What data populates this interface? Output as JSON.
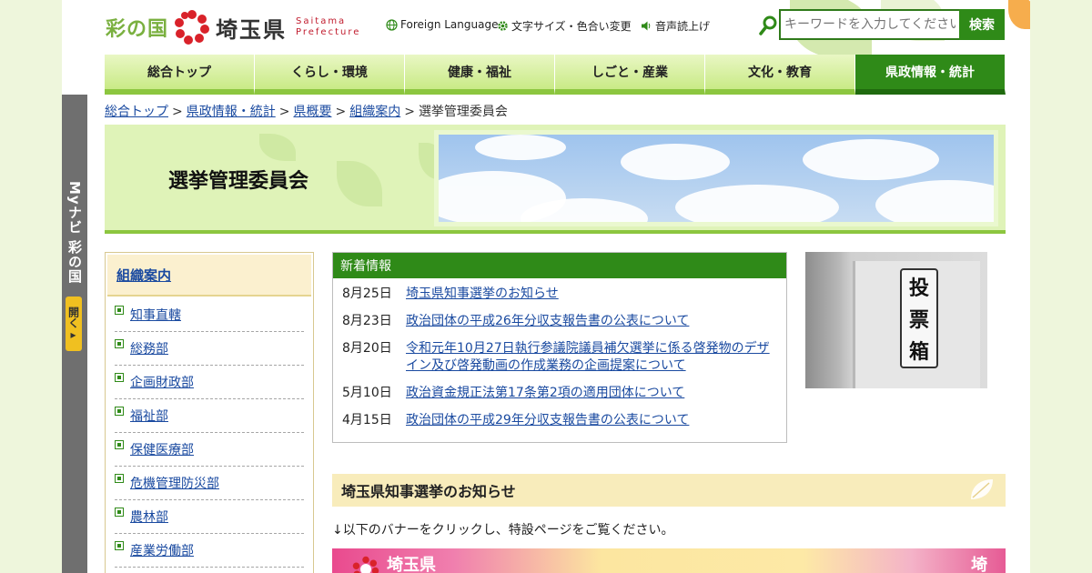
{
  "header": {
    "logo_kuni": "彩の国",
    "logo_ken": "埼玉県",
    "logo_en_line1": "Saitama",
    "logo_en_line2": "Prefecture",
    "util_foreign": "Foreign Language",
    "util_size": "文字サイズ・色合い変更",
    "util_voice": "音声読上げ",
    "search_placeholder": "キーワードを入力してください",
    "search_button": "検索"
  },
  "nav": {
    "items": [
      "総合トップ",
      "くらし・環境",
      "健康・福祉",
      "しごと・産業",
      "文化・教育",
      "県政情報・統計"
    ],
    "active_index": 5
  },
  "breadcrumb": {
    "items": [
      "総合トップ",
      "県政情報・統計",
      "県概要",
      "組織案内"
    ],
    "current": "選挙管理委員会",
    "separator": ">"
  },
  "banner": {
    "title": "選挙管理委員会"
  },
  "mynavi": {
    "label": "Myナビ 彩の国",
    "open_label": "開く▸"
  },
  "sidemenu": {
    "heading": "組織案内",
    "items": [
      "知事直轄",
      "総務部",
      "企画財政部",
      "福祉部",
      "保健医療部",
      "危機管理防災部",
      "農林部",
      "産業労働部"
    ]
  },
  "news": {
    "heading": "新着情報",
    "items": [
      {
        "date": "8月25日",
        "title": "埼玉県知事選挙のお知らせ"
      },
      {
        "date": "8月23日",
        "title": "政治団体の平成26年分収支報告書の公表について"
      },
      {
        "date": "8月20日",
        "title": "令和元年10月27日執行参議院議員補欠選挙に係る啓発物のデザイン及び啓発動画の作成業務の企画提案について"
      },
      {
        "date": "5月10日",
        "title": "政治資金規正法第17条第2項の適用団体について"
      },
      {
        "date": "4月15日",
        "title": "政治団体の平成29年分収支報告書の公表について"
      }
    ]
  },
  "photo": {
    "box_text": [
      "投",
      "票",
      "箱"
    ]
  },
  "section": {
    "heading": "埼玉県知事選挙のお知らせ",
    "text": "↓以下のバナーをクリックし、特設ページをご覧ください。",
    "promo_left": "埼玉県",
    "promo_right": "埼"
  },
  "colors": {
    "brand_green": "#2f8a18",
    "nav_light": "#c9ea86",
    "link": "#1a4aa0",
    "section_bg": "#f8ecbb"
  }
}
